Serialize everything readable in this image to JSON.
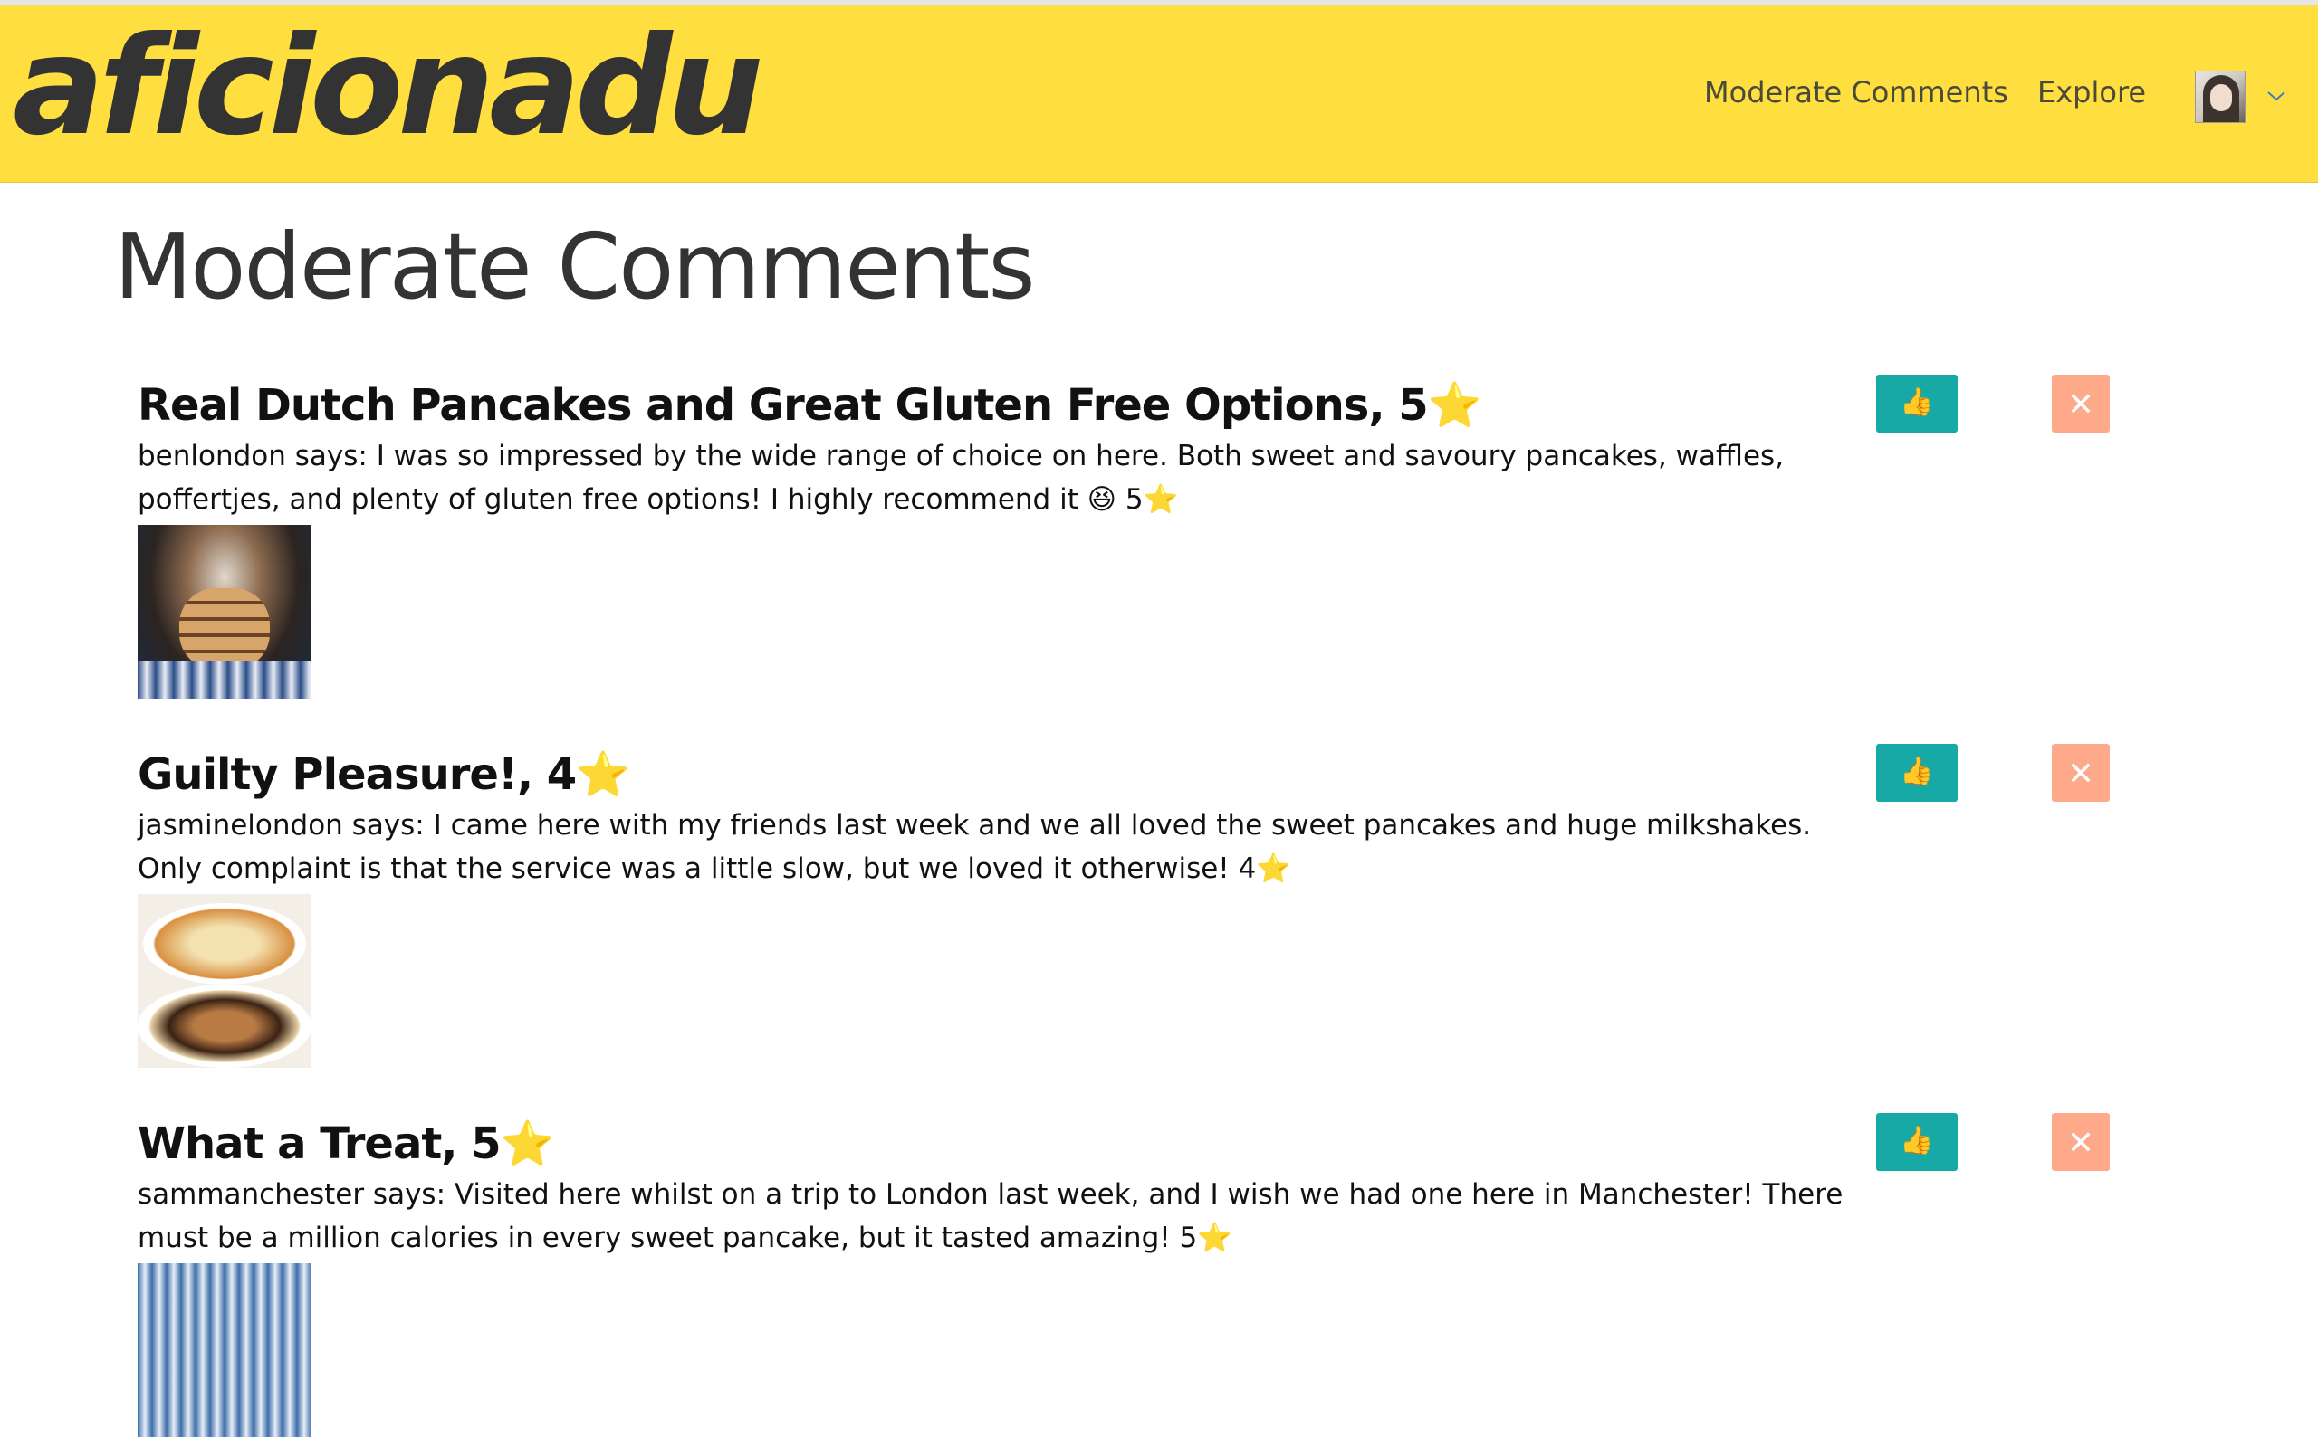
{
  "navbar": {
    "logo_text": "aficionadu",
    "links": [
      {
        "label": "Moderate Comments"
      },
      {
        "label": "Explore"
      }
    ],
    "avatar_icon": "user-avatar",
    "dropdown_icon": "chevron-down-icon",
    "background_color": "#ffdf3f"
  },
  "page": {
    "title": "Moderate Comments"
  },
  "comments": [
    {
      "title": "Real Dutch Pancakes and Great Gluten Free Options, 5⭐",
      "body": "benlondon says: I was so impressed by the wide range of choice on here. Both sweet and savoury pancakes, waffles, poffertjes, and plenty of gluten free options! I highly recommend it 😆  5⭐",
      "image_icon": "pancake-stack-photo",
      "approve_icon": "👍",
      "reject_icon": "✕"
    },
    {
      "title": "Guilty Pleasure!, 4⭐",
      "body": "jasminelondon says: I came here with my friends last week and we all loved the sweet pancakes and huge milkshakes. Only complaint is that the service was a little slow, but we loved it otherwise! 4⭐",
      "image_icon": "crepes-plate-photo",
      "approve_icon": "👍",
      "reject_icon": "✕"
    },
    {
      "title": "What a Treat, 5⭐",
      "body": "sammanchester says: Visited here whilst on a trip to London last week, and I wish we had one here in Manchester! There must be a million calories in every sweet pancake, but it tasted amazing! 5⭐",
      "image_icon": "treat-photo",
      "approve_icon": "👍",
      "reject_icon": "✕"
    }
  ],
  "colors": {
    "approve": "#17a9a6",
    "reject": "#fda98a"
  }
}
